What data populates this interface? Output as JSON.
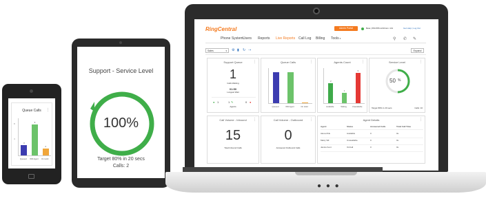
{
  "phone": {
    "card_title": "Queue Calls",
    "bars": [
      {
        "label": "Queued",
        "value": 3,
        "color": "#3c3cb0"
      },
      {
        "label": "WR Agent",
        "value": 9,
        "color": "#6cc36a"
      },
      {
        "label": "On Hold",
        "value": 2,
        "color": "#f0a63a"
      }
    ],
    "axis_top": "8",
    "axis_mid": "4",
    "bar_value_labels": [
      "3",
      "9",
      "2"
    ]
  },
  "tablet": {
    "title": "Support - Service Level",
    "percent_text": "100%",
    "percent_value": 100,
    "target_text": "Target 80% in 20 secs",
    "calls_text": "Calls: 2",
    "ring_color": "#3fae49"
  },
  "laptop": {
    "logo": "RingCentral",
    "header_button": "Admin Portal",
    "status_text": "Beta | 650-555-1234 Ext. 101",
    "help_text": "Get Help | Log Out",
    "nav": [
      "Phone System",
      "Users",
      "Reports",
      "Live Reports",
      "Call Log",
      "Billing",
      "Tools"
    ],
    "active_nav": "Live Reports",
    "nav_colors": {
      "active": "#f47b20",
      "inactive": "#444444"
    },
    "toolbar": {
      "select_value": "Sales",
      "expand_label": "Expand"
    },
    "support_queue": {
      "title": "Support Queue",
      "calls_waiting_value": "1",
      "calls_waiting_label": "Calls Waiting",
      "longest_value": "01:50",
      "longest_label": "Longest Wait",
      "agents_label": "Agents",
      "agents_green": "1",
      "agents_idle": "1",
      "agents_red": "0"
    },
    "queue_calls": {
      "title": "Queue Calls",
      "bars": [
        {
          "label": "Queued",
          "value": 7,
          "color": "#3c3cb0"
        },
        {
          "label": "WR Agent",
          "value": 7,
          "color": "#6cc36a"
        },
        {
          "label": "On Hold",
          "value": 0,
          "color": "#f0a63a"
        }
      ]
    },
    "agents_count": {
      "title": "Agents Count",
      "bars": [
        {
          "label": "Available",
          "value": 2,
          "color": "#3faa4a"
        },
        {
          "label": "Talking",
          "value": 1,
          "color": "#6cc36a"
        },
        {
          "label": "Unavailable",
          "value": 3,
          "color": "#e53935"
        }
      ],
      "value_labels": [
        "2",
        "1",
        "3"
      ]
    },
    "service_level": {
      "title": "Service Level",
      "percent_text": "50",
      "percent_value": 50,
      "target_text": "Target 80% in 20 secs",
      "calls_text": "Calls: 10"
    },
    "inbound": {
      "title": "Call Volume - Inbound",
      "value": "15",
      "label": "Total Inbound Calls"
    },
    "outbound": {
      "title": "Call Volume - Outbound",
      "value": "0",
      "label": "Answered Outbound Calls"
    },
    "agent_details": {
      "title": "Agent Details",
      "columns": [
        "Agent",
        "Status",
        "Answered Calls",
        "Total Call Time"
      ],
      "rows": [
        [
          "Alexa Zink",
          "Available",
          "0",
          "0s"
        ],
        [
          "Marty Sill",
          "Unavailable",
          "0",
          "0s"
        ],
        [
          "Janice Kent",
          "OnCall",
          "0",
          "0s"
        ]
      ]
    }
  }
}
